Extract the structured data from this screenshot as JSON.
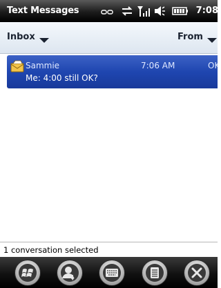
{
  "titlebar": {
    "title": "Text Messages",
    "time": "7:08",
    "status_icons": [
      "signal-strength-icon",
      "sync-icon",
      "cellular-signal-icon",
      "speaker-icon",
      "battery-icon"
    ]
  },
  "header": {
    "folder_label": "Inbox",
    "sort_label": "From"
  },
  "messages": [
    {
      "sender": "Sammie",
      "time": "7:06 AM",
      "status": "OK",
      "preview": "Me: 4:00 still OK?",
      "selected": true,
      "icon": "message-envelope-icon"
    }
  ],
  "status_line": "1 conversation selected",
  "bottom_buttons": [
    "start-menu-icon",
    "contacts-icon",
    "keyboard-icon",
    "menu-icon",
    "close-icon"
  ],
  "colors": {
    "selection": "#1f46b0",
    "titlebar": "#000000",
    "header": "#dde6f0"
  }
}
